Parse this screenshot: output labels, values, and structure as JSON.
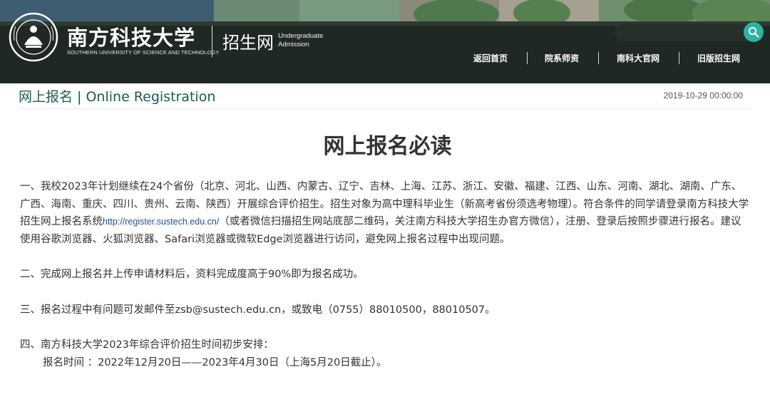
{
  "header": {
    "logo": {
      "name_cn": "南方科技大学",
      "name_en": "SOUTHERN UNIVERSITY OF SCIENCE AND TECHNOLOGY"
    },
    "site_name": "招生网",
    "site_sub_line1": "Undergraduate",
    "site_sub_line2": "Admission",
    "search_icon": "search-icon",
    "nav": [
      "返回首页",
      "院系师资",
      "南科大官网",
      "旧版招生网"
    ]
  },
  "page": {
    "title": "网上报名 | Online Registration",
    "date": "2019-10-29 00:00:00"
  },
  "article": {
    "title": "网上报名必读",
    "p1_before_link": "一、我校2023年计划继续在24个省份（北京、河北、山西、内蒙古、辽宁、吉林、上海、江苏、浙江、安徽、福建、江西、山东、河南、湖北、湖南、广东、广西、海南、重庆、四川、贵州、云南、陕西）开展综合评价招生。招生对象为高中理科毕业生（新高考省份须选考物理）。符合条件的同学请登录南方科技大学招生网上报名系统",
    "p1_link": "http://register.sustech.edu.cn/",
    "p1_after_link": "（或者微信扫描招生网站底部二维码，关注南方科技大学招生办官方微信），注册、登录后按照步骤进行报名。建议使用谷歌浏览器、火狐浏览器、Safari浏览器或微软Edge浏览器进行访问，避免网上报名过程中出现问题。",
    "p2": "二、完成网上报名并上传申请材料后，资料完成度高于90%即为报名成功。",
    "p3": "三、报名过程中有问题可发邮件至zsb@sustech.edu.cn，或致电（0755）88010500，88010507。",
    "p4_line1": "四、南方科技大学2023年综合评价招生时间初步安排：",
    "p4_line2": "报名时间 ：2022年12月20日——2023年4月30日（上海5月20日截止）。"
  },
  "colors": {
    "accent": "#1a5c4f",
    "search_button": "#2bb3a5",
    "link": "#1f4f9e"
  }
}
